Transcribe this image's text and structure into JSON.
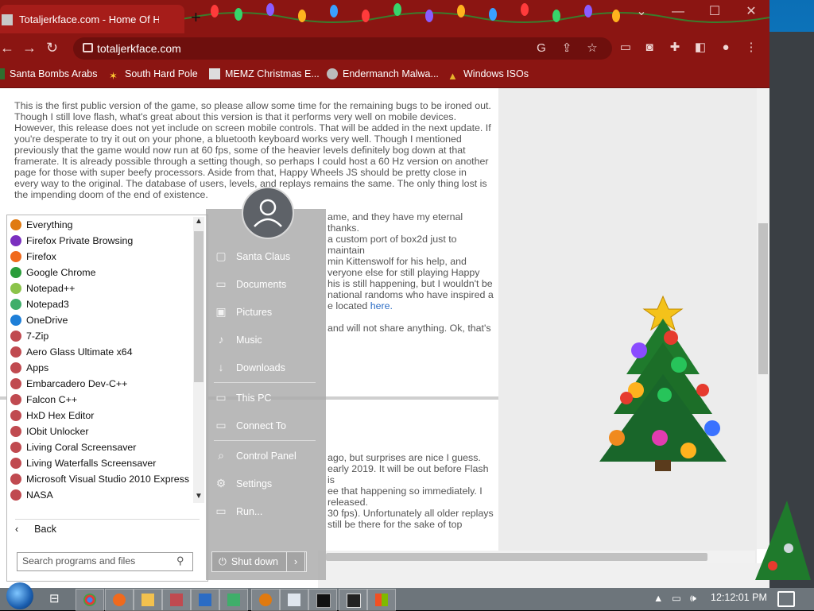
{
  "browser": {
    "tab_title": "Totaljerkface.com - Home Of Ha",
    "new_tab": "+",
    "url": "totaljerkface.com",
    "window_min": "—",
    "window_max": "☐",
    "window_close": "✕",
    "bookmarks": [
      {
        "label": "Santa Bombs Arabs",
        "icon": "flag-icon"
      },
      {
        "label": "South Hard Pole",
        "icon": "star-icon"
      },
      {
        "label": "MEMZ Christmas E...",
        "icon": "image-icon"
      },
      {
        "label": "Endermanch Malwa...",
        "icon": "avatar-icon"
      },
      {
        "label": "Windows ISOs",
        "icon": "tree-icon"
      }
    ]
  },
  "page": {
    "p1": "This is the first public version of the game, so please allow some time for the remaining bugs to be ironed out. Though I still love flash, what's great about this version is that it performs very well on mobile devices. However, this release does not yet include on screen mobile controls. That will be added in the next update. If you're desperate to try it out on your phone, a bluetooth keyboard works very well. Though I mentioned previously that the game would now run at 60 fps, some of the heavier levels definitely bog down at that framerate. It is already possible through a setting though, so perhaps I could host a 60 Hz version on another page for those with super beefy processors. Aside from that, Happy Wheels JS should be pretty close in every way to the original. The database of users, levels, and replays remains the same. The only thing lost is the impending doom of the end of existence.",
    "p2a": "ame, and they have my eternal thanks.",
    "p2b": "a custom port of box2d just to maintain",
    "p2c": "min Kittenswolf for his help, and",
    "p2d": "veryone else for still playing Happy",
    "p2e": "his is still happening, but I wouldn't be",
    "p2f": "national randoms who have inspired a",
    "p3a": "e located ",
    "p3_link": "here.",
    "p4a": "and will not share anything. Ok, that's",
    "p5a": "ago, but surprises are nice I guess.",
    "p5b": "early 2019. It will be out before Flash is",
    "p5c": "ee that happening so immediately. I",
    "p5d": "released.",
    "p6a": "30 fps). Unfortunately all older replays",
    "p6b": "still be there for the sake of top"
  },
  "start_menu": {
    "programs": [
      {
        "label": "Everything",
        "color": "#e07a10"
      },
      {
        "label": "Firefox Private Browsing",
        "color": "#7b2fbf"
      },
      {
        "label": "Firefox",
        "color": "#f06a1d"
      },
      {
        "label": "Google Chrome",
        "color": "#2a9d3a"
      },
      {
        "label": "Notepad++",
        "color": "#8bc34a"
      },
      {
        "label": "Notepad3",
        "color": "#3fae6a"
      },
      {
        "label": "OneDrive",
        "color": "#1e7fd8"
      },
      {
        "label": "7-Zip",
        "color": "#c04a50"
      },
      {
        "label": "Aero Glass Ultimate x64",
        "color": "#c04a50"
      },
      {
        "label": "Apps",
        "color": "#c04a50"
      },
      {
        "label": "Embarcadero Dev-C++",
        "color": "#c04a50"
      },
      {
        "label": "Falcon C++",
        "color": "#c04a50"
      },
      {
        "label": "HxD Hex Editor",
        "color": "#c04a50"
      },
      {
        "label": "IObit Unlocker",
        "color": "#c04a50"
      },
      {
        "label": "Living Coral Screensaver",
        "color": "#c04a50"
      },
      {
        "label": "Living Waterfalls Screensaver",
        "color": "#c04a50"
      },
      {
        "label": "Microsoft Visual Studio 2010 Express",
        "color": "#c04a50"
      },
      {
        "label": "NASA",
        "color": "#c04a50"
      }
    ],
    "back_label": "Back",
    "search_placeholder": "Search programs and files",
    "right_items": [
      {
        "label": "Santa Claus",
        "icon": "user-icon"
      },
      {
        "label": "Documents",
        "icon": "documents-icon"
      },
      {
        "label": "Pictures",
        "icon": "pictures-icon"
      },
      {
        "label": "Music",
        "icon": "music-icon"
      },
      {
        "label": "Downloads",
        "icon": "downloads-icon"
      },
      {
        "label": "This PC",
        "icon": "computer-icon"
      },
      {
        "label": "Connect To",
        "icon": "connect-icon"
      },
      {
        "label": "Control Panel",
        "icon": "control-panel-icon"
      },
      {
        "label": "Settings",
        "icon": "gear-icon"
      },
      {
        "label": "Run...",
        "icon": "run-icon"
      }
    ],
    "shutdown_label": "Shut down"
  },
  "taskbar": {
    "clock": "12:12:01 PM"
  }
}
